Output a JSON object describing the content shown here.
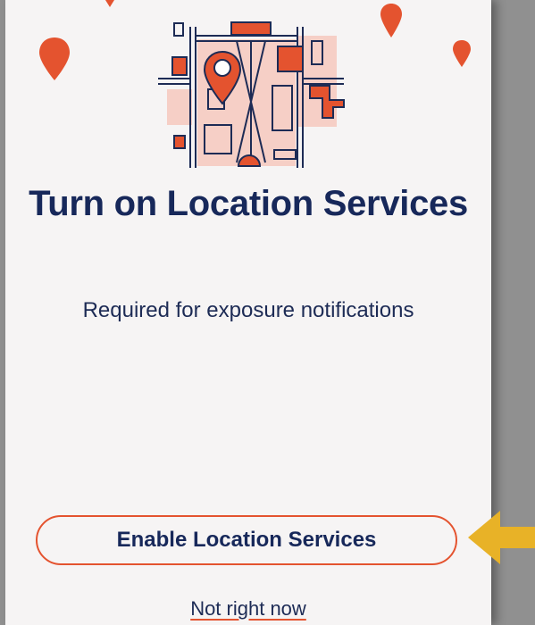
{
  "screen": {
    "title": "Turn on Location Services",
    "subtitle": "Required for exposure notifications"
  },
  "actions": {
    "enable_label": "Enable Location Services",
    "dismiss_label": "Not right now"
  },
  "icons": {
    "hero": "map-location-illustration-icon",
    "decor": "map-pin-icon",
    "pointer": "arrow-left-icon"
  },
  "colors": {
    "accent": "#e4532f",
    "title": "#17285a",
    "background": "#f6f4f4",
    "pointer": "#e8b227"
  }
}
